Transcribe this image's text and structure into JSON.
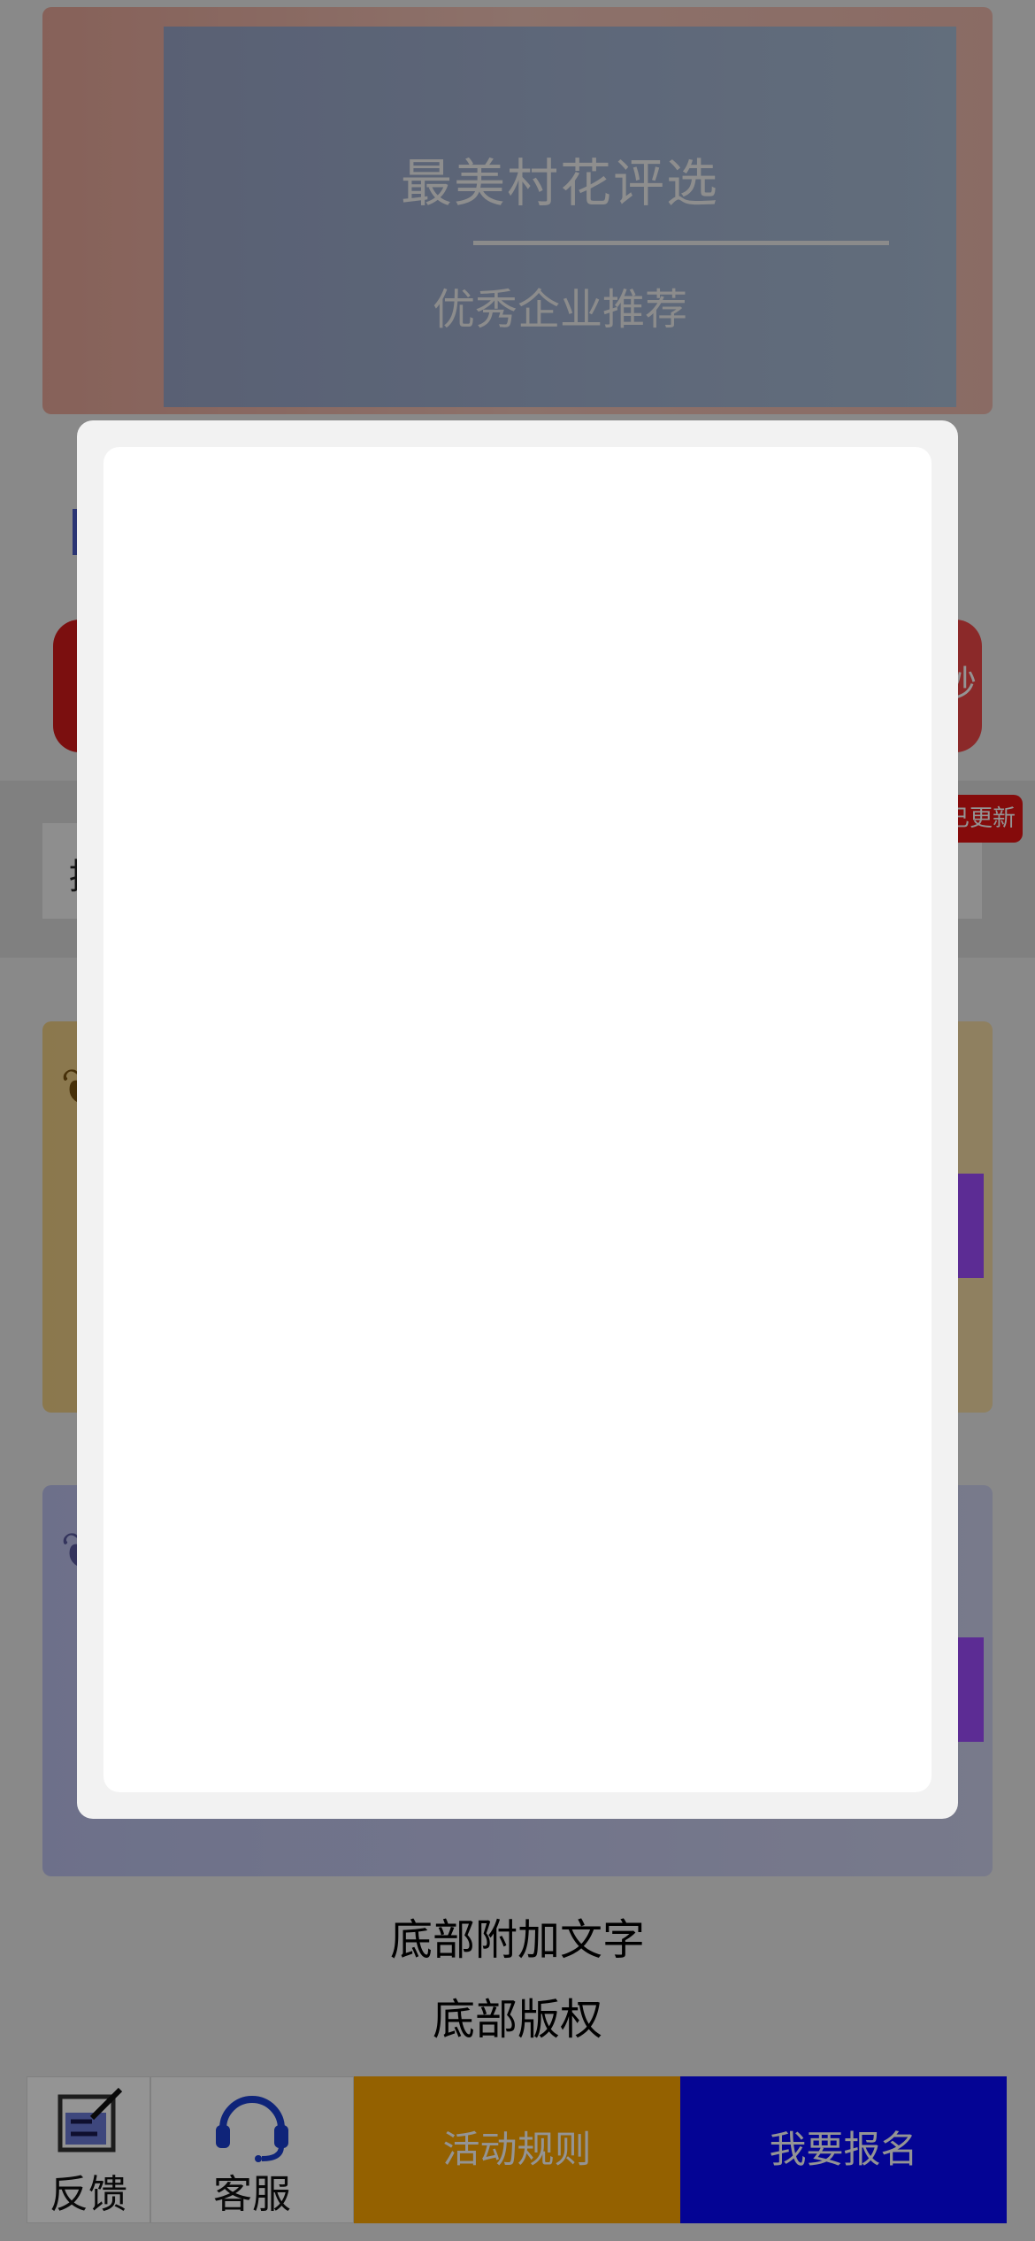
{
  "banner": {
    "title": "最美村花评选",
    "subtitle": "优秀企业推荐"
  },
  "countdown": {
    "suffix": "秒"
  },
  "notice": {
    "text": "提",
    "badge": "已更新"
  },
  "footer": {
    "extra_text": "底部附加文字",
    "copyright": "底部版权"
  },
  "tabbar": {
    "feedback_label": "反馈",
    "service_label": "客服",
    "rules_label": "活动规则",
    "signup_label": "我要报名"
  },
  "colors": {
    "rules_button": "#ffa800",
    "signup_button": "#0808ff",
    "badge": "#e61414",
    "overlay": "rgba(0,0,0,0.42)"
  },
  "icons": {
    "feedback": "edit-icon",
    "service": "headset-icon"
  }
}
